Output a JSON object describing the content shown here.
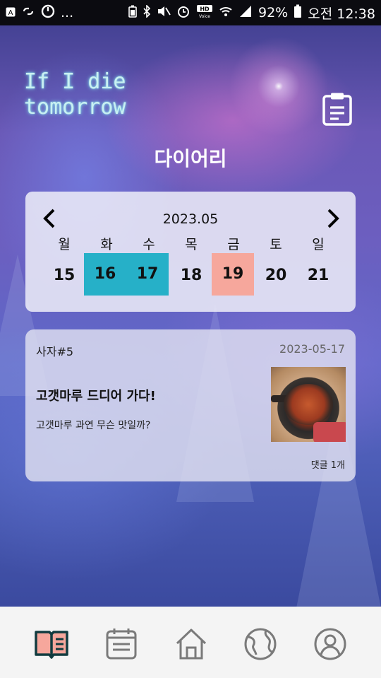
{
  "status_bar": {
    "left_icons": [
      "a-icon",
      "link-icon",
      "timer-icon",
      "more-dots"
    ],
    "more": "...",
    "battery": "92%",
    "time": "오전 12:38"
  },
  "header": {
    "logo_line1": "If I die",
    "logo_line2": "tomorrow",
    "title": "다이어리"
  },
  "calendar": {
    "month": "2023.05",
    "weekdays": [
      "월",
      "화",
      "수",
      "목",
      "금",
      "토",
      "일"
    ],
    "days": [
      "15",
      "16",
      "17",
      "18",
      "19",
      "20",
      "21"
    ],
    "highlight_colors": {
      "teal": "#26b0c8",
      "salmon": "#f6a79c"
    }
  },
  "post": {
    "tag": "사자#5",
    "date": "2023-05-17",
    "title": "고갯마루 드디어 가다!",
    "body": "고갯마루 과연 무슨 맛일까?",
    "comments": "댓글 1개"
  },
  "bottom_nav": {
    "items": [
      "diary-book-icon",
      "calendar-icon",
      "home-icon",
      "globe-icon",
      "profile-icon"
    ],
    "active_color": "#f6a79c"
  }
}
